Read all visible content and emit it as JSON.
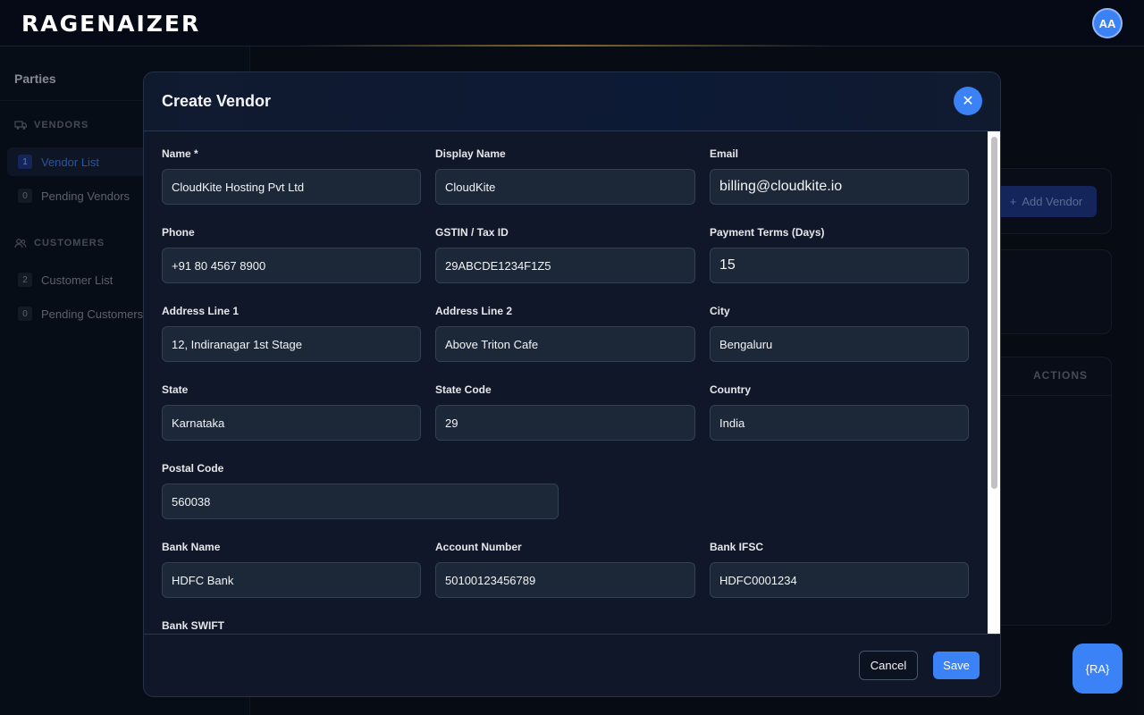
{
  "header": {
    "logo_text": "RAGENAIZER",
    "avatar_initials": "AA"
  },
  "sidebar": {
    "title": "Parties",
    "vendors_section": "VENDORS",
    "customers_section": "CUSTOMERS",
    "items": [
      {
        "label": "Vendor List",
        "badge": "1",
        "active": true
      },
      {
        "label": "Pending Vendors",
        "badge": "0",
        "active": false
      },
      {
        "label": "Customer List",
        "badge": "2",
        "active": false
      },
      {
        "label": "Pending Customers",
        "badge": "0",
        "active": false
      }
    ]
  },
  "main": {
    "add_vendor_label": "Add Vendor",
    "actions_column": "ACTIONS"
  },
  "modal": {
    "title": "Create Vendor",
    "fields": {
      "name": {
        "label": "Name *",
        "value": "CloudKite Hosting Pvt Ltd"
      },
      "display_name": {
        "label": "Display Name",
        "value": "CloudKite"
      },
      "email": {
        "label": "Email",
        "value": "billing@cloudkite.io"
      },
      "phone": {
        "label": "Phone",
        "value": "+91 80 4567 8900"
      },
      "gstin": {
        "label": "GSTIN / Tax ID",
        "value": "29ABCDE1234F1Z5"
      },
      "payment_terms": {
        "label": "Payment Terms (Days)",
        "value": "15"
      },
      "address_line_1": {
        "label": "Address Line 1",
        "value": "12, Indiranagar 1st Stage"
      },
      "address_line_2": {
        "label": "Address Line 2",
        "value": "Above Triton Cafe"
      },
      "city": {
        "label": "City",
        "value": "Bengaluru"
      },
      "state": {
        "label": "State",
        "value": "Karnataka"
      },
      "state_code": {
        "label": "State Code",
        "value": "29"
      },
      "country": {
        "label": "Country",
        "value": "India"
      },
      "postal_code": {
        "label": "Postal Code",
        "value": "560038"
      },
      "bank_name": {
        "label": "Bank Name",
        "value": "HDFC Bank"
      },
      "account_number": {
        "label": "Account Number",
        "value": "50100123456789"
      },
      "bank_ifsc": {
        "label": "Bank IFSC",
        "value": "HDFC0001234"
      },
      "bank_swift": {
        "label": "Bank SWIFT"
      }
    },
    "cancel_label": "Cancel",
    "save_label": "Save"
  },
  "fab_label": "{RA}",
  "colors": {
    "accent": "#3b82f6",
    "background": "#0b1220",
    "modal": "#0f1729"
  }
}
